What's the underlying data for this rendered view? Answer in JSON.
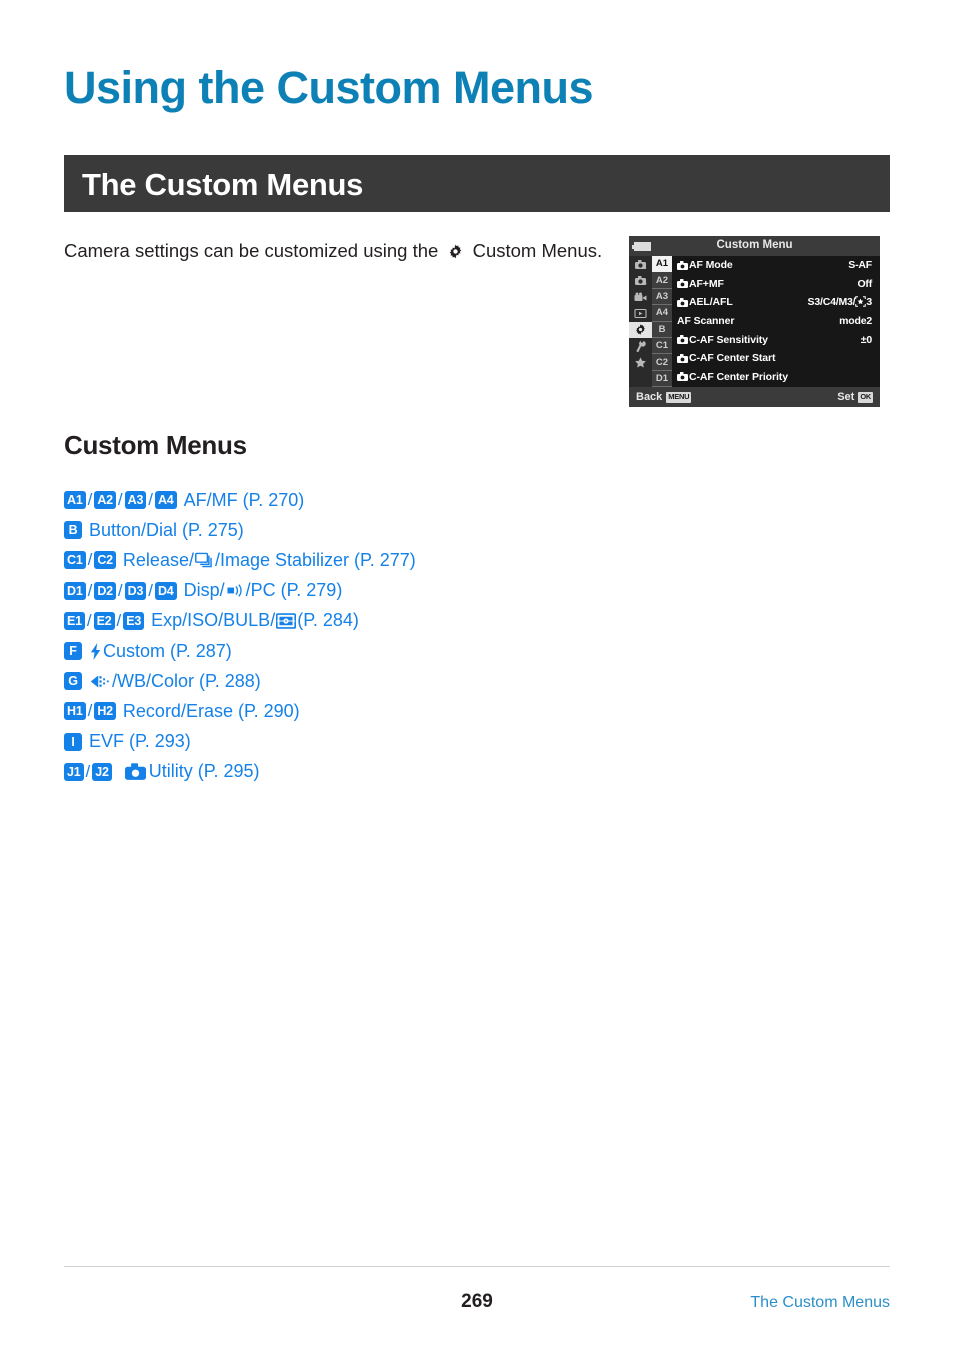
{
  "page": {
    "chapter_title": "Using the Custom Menus",
    "section_banner": "The Custom Menus",
    "intro_before_icon": "Camera settings can be customized using the",
    "intro_after_icon": "Custom Menus.",
    "intro_icon": "gear-icon",
    "subheading": "Custom Menus",
    "page_number": "269",
    "footer_label": "The Custom Menus",
    "accent_blue": "#1481e8",
    "title_blue": "#0d81b5",
    "banner_dark": "#3a3a3a",
    "footer_blue": "#2a8fc9"
  },
  "lcd": {
    "title": "Custom Menu",
    "battery_icon": "battery-icon",
    "rail": [
      {
        "icon": "shooting-menu-1-icon",
        "active": false
      },
      {
        "icon": "shooting-menu-2-icon",
        "active": false
      },
      {
        "icon": "video-menu-icon",
        "active": false
      },
      {
        "icon": "playback-menu-icon",
        "active": false
      },
      {
        "icon": "custom-menu-gear-icon",
        "active": true
      },
      {
        "icon": "setup-wrench-icon",
        "active": false
      },
      {
        "icon": "my-menu-star-icon",
        "active": false
      }
    ],
    "tabs": [
      {
        "label": "A1",
        "active": true
      },
      {
        "label": "A2",
        "active": false
      },
      {
        "label": "A3",
        "active": false
      },
      {
        "label": "A4",
        "active": false
      },
      {
        "label": "B",
        "active": false
      },
      {
        "label": "C1",
        "active": false
      },
      {
        "label": "C2",
        "active": false
      },
      {
        "label": "D1",
        "active": false
      }
    ],
    "rows": [
      {
        "camera_icon": true,
        "label": "AF Mode",
        "value": "S-AF",
        "value_star": false
      },
      {
        "camera_icon": true,
        "label": "AF+MF",
        "value": "Off",
        "value_star": false
      },
      {
        "camera_icon": true,
        "label": "AEL/AFL",
        "value_prefix": "S3/C4/M3/",
        "value_suffix": "3",
        "value_star": true,
        "value": "S3/C4/M3/[star]3"
      },
      {
        "camera_icon": false,
        "label": "AF Scanner",
        "value": "mode2",
        "value_star": false
      },
      {
        "camera_icon": true,
        "label": "C-AF Sensitivity",
        "value": "±0",
        "value_star": false
      },
      {
        "camera_icon": true,
        "label": "C-AF Center Start",
        "value": "",
        "value_star": false
      },
      {
        "camera_icon": true,
        "label": "C-AF Center Priority",
        "value": "",
        "value_star": false
      }
    ],
    "footer": {
      "back_label": "Back",
      "back_key": "MENU",
      "set_label": "Set",
      "set_key": "OK"
    }
  },
  "menu_links": [
    {
      "badges": [
        "A1",
        "A2",
        "A3",
        "A4"
      ],
      "text_parts": [
        {
          "type": "text",
          "value": "AF/MF (P. 270)"
        }
      ]
    },
    {
      "badges": [
        "B"
      ],
      "text_parts": [
        {
          "type": "text",
          "value": "Button/Dial (P. 275)"
        }
      ]
    },
    {
      "badges": [
        "C1",
        "C2"
      ],
      "text_parts": [
        {
          "type": "text",
          "value": "Release/"
        },
        {
          "type": "icon",
          "value": "sequential-shooting-icon"
        },
        {
          "type": "text",
          "value": "/Image Stabilizer (P. 277)"
        }
      ]
    },
    {
      "badges": [
        "D1",
        "D2",
        "D3",
        "D4"
      ],
      "text_parts": [
        {
          "type": "text",
          "value": "Disp/"
        },
        {
          "type": "icon",
          "value": "beep-sound-icon"
        },
        {
          "type": "text",
          "value": "/PC (P. 279)"
        }
      ]
    },
    {
      "badges": [
        "E1",
        "E2",
        "E3"
      ],
      "text_parts": [
        {
          "type": "text",
          "value": "Exp/ISO/BULB/"
        },
        {
          "type": "icon",
          "value": "metering-mode-icon"
        },
        {
          "type": "text",
          "value": " (P. 284)"
        }
      ]
    },
    {
      "badges": [
        "F"
      ],
      "text_parts": [
        {
          "type": "icon",
          "value": "flash-bolt-icon"
        },
        {
          "type": "text",
          "value": " Custom (P. 287)"
        }
      ]
    },
    {
      "badges": [
        "G"
      ],
      "text_parts": [
        {
          "type": "icon",
          "value": "picture-mode-icon"
        },
        {
          "type": "text",
          "value": "/WB/Color (P. 288)"
        }
      ]
    },
    {
      "badges": [
        "H1",
        "H2"
      ],
      "text_parts": [
        {
          "type": "text",
          "value": "Record/Erase (P. 290)"
        }
      ]
    },
    {
      "badges": [
        "I"
      ],
      "text_parts": [
        {
          "type": "text",
          "value": "EVF (P. 293)"
        }
      ]
    },
    {
      "badges": [
        "J1",
        "J2"
      ],
      "text_parts": [
        {
          "type": "icon",
          "value": "camera-body-icon"
        },
        {
          "type": "text",
          "value": " Utility (P. 295)"
        }
      ]
    }
  ]
}
